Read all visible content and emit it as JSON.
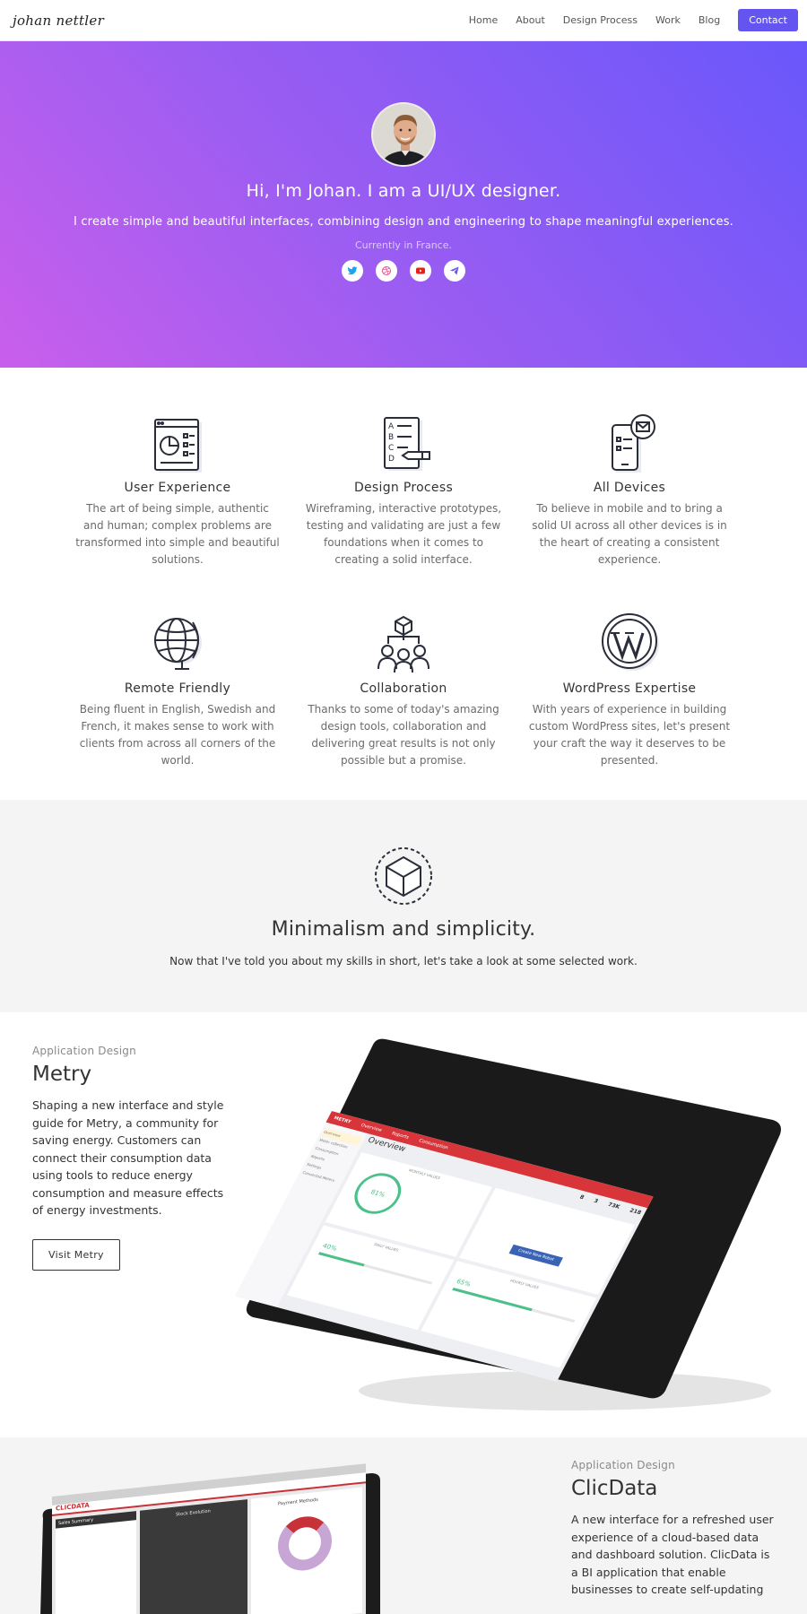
{
  "nav": {
    "logo": "johan nettler",
    "items": [
      "Home",
      "About",
      "Design Process",
      "Work",
      "Blog"
    ],
    "contact": "Contact"
  },
  "hero": {
    "title": "Hi, I'm Johan. I am a UI/UX designer.",
    "lead": "I create simple and beautiful interfaces, combining design and engineering to shape meaningful experiences.",
    "location": "Currently in France.",
    "socials": [
      "twitter-icon",
      "dribbble-icon",
      "youtube-icon",
      "telegram-icon"
    ]
  },
  "features": [
    {
      "title": "User Experience",
      "icon": "browser-chart-icon",
      "text": "The art of being simple, authentic and human; complex problems are transformed into simple and beautiful solutions."
    },
    {
      "title": "Design Process",
      "icon": "checklist-pencil-icon",
      "text": "Wireframing, interactive prototypes, testing and validating are just a few foundations when it comes to creating a solid interface."
    },
    {
      "title": "All Devices",
      "icon": "mobile-mail-icon",
      "text": "To believe in mobile and to bring a solid UI across all other devices is in the heart of creating a consistent experience."
    },
    {
      "title": "Remote Friendly",
      "icon": "globe-icon",
      "text": "Being fluent in English, Swedish and French, it makes sense to work with clients from across all corners of the world."
    },
    {
      "title": "Collaboration",
      "icon": "team-icon",
      "text": "Thanks to some of today's amazing design tools, collaboration and delivering great results is not only possible but a promise."
    },
    {
      "title": "WordPress Expertise",
      "icon": "wordpress-icon",
      "text": "With years of experience in building custom WordPress sites, let's present your craft the way it deserves to be presented."
    }
  ],
  "mini": {
    "title": "Minimalism and simplicity.",
    "text": "Now that I've told you about my skills in short, let's take a look at some selected work."
  },
  "metry": {
    "category": "Application Design",
    "title": "Metry",
    "desc": "Shaping a new interface and style guide for Metry, a community for saving energy. Customers can connect their consumption data using tools to reduce energy consumption and measure effects of energy investments.",
    "button": "Visit Metry",
    "screen": {
      "brand": "METRY",
      "tabs": [
        "Overview",
        "Reports",
        "Consumption"
      ],
      "heading": "Overview",
      "stats": [
        "8",
        "3",
        "73K",
        "218"
      ],
      "pct1": "81%",
      "pct2": "40%",
      "pct3": "65%",
      "cta": "Create New Robot",
      "monthly": "MONTHLY VALUES",
      "daily": "DAILY VALUES",
      "hourly": "HOURLY VALUES",
      "side": [
        "Overview",
        "Meter collection",
        "Consumption",
        "Reports",
        "Settings",
        "Connected Meters"
      ]
    }
  },
  "clic": {
    "category": "Application Design",
    "title": "ClicData",
    "desc": "A new interface for a refreshed user experience of a cloud-based data and dashboard solution. ClicData is a BI application that enable businesses to create self-updating",
    "screen": {
      "brand": "CLICDATA",
      "panel1": "Sales Summary",
      "panel2": "Stock Evolution",
      "panel3": "Payment Methods"
    }
  }
}
